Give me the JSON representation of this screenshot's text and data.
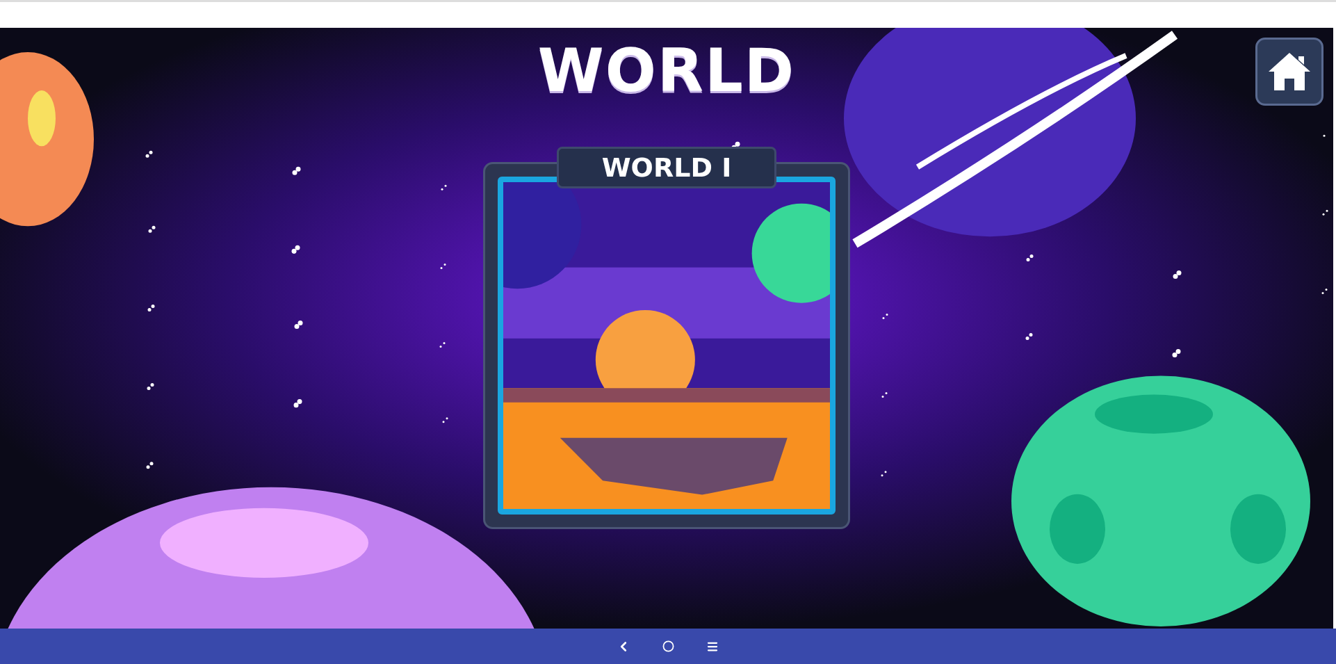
{
  "title": "WORLD",
  "worlds": [
    {
      "label": "WORLD I"
    }
  ]
}
